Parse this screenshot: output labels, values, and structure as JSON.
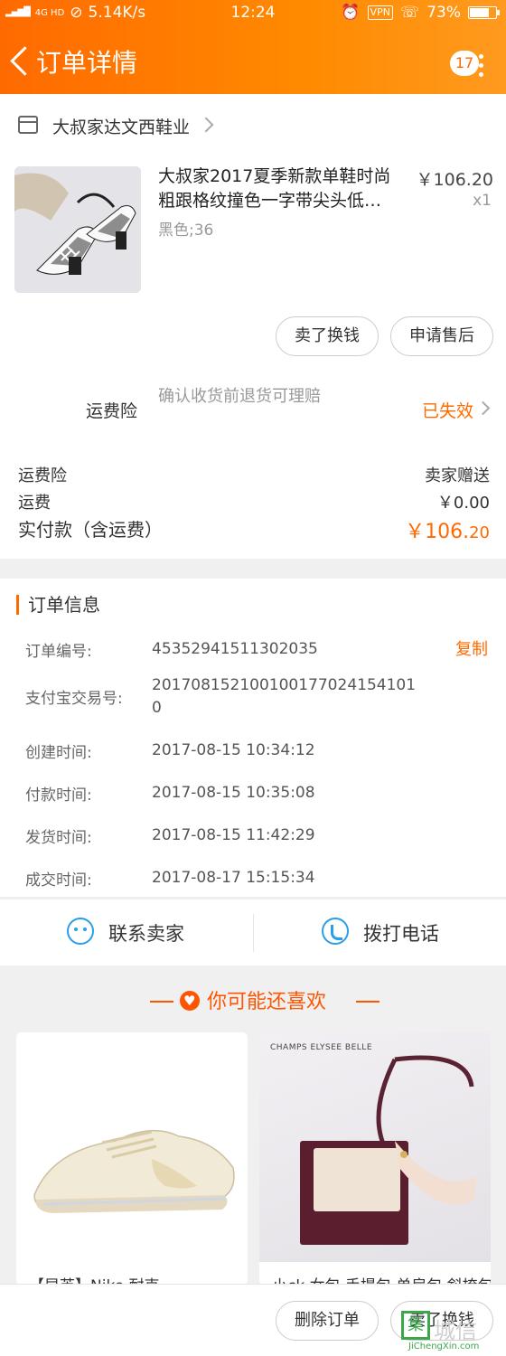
{
  "status_bar": {
    "network": "4G HD",
    "speed": "5.14K/s",
    "time": "12:24",
    "vpn": "VPN",
    "battery": "73%"
  },
  "header": {
    "title": "订单详情",
    "badge_count": "17",
    "back_icon": "chevron-left-icon",
    "more_icon": "more-vertical-icon"
  },
  "shop": {
    "name": "大叔家达文西鞋业"
  },
  "product": {
    "title": "大叔家2017夏季新款单鞋时尚粗跟格纹撞色一字带尖头低…",
    "spec": "黑色;36",
    "price": "￥106.20",
    "qty": "x1"
  },
  "product_actions": {
    "sell": "卖了换钱",
    "aftersale": "申请售后"
  },
  "shipping_insurance": {
    "label": "运费险",
    "desc": "确认收货前退货可理赔",
    "status": "已失效"
  },
  "fees": {
    "insurance_label": "运费险",
    "insurance_value": "卖家赠送",
    "shipping_label": "运费",
    "shipping_value": "￥0.00",
    "total_label": "实付款（含运费）",
    "total_int": "￥106.",
    "total_dec": "20"
  },
  "order_info": {
    "title": "订单信息",
    "copy": "复制",
    "rows": [
      {
        "k": "订单编号:",
        "v": "45352941511302035"
      },
      {
        "k": "支付宝交易号:",
        "v": "2017081521001001770241541010"
      },
      {
        "k": "创建时间:",
        "v": "2017-08-15 10:34:12"
      },
      {
        "k": "付款时间:",
        "v": "2017-08-15 10:35:08"
      },
      {
        "k": "发货时间:",
        "v": "2017-08-15 11:42:29"
      },
      {
        "k": "成交时间:",
        "v": "2017-08-17 15:15:34"
      }
    ]
  },
  "contact": {
    "seller": "联系卖家",
    "phone": "拨打电话"
  },
  "recommend": {
    "title": "你可能还喜欢",
    "items": [
      {
        "name": "【早芙】Nike 耐克"
      },
      {
        "name": "小ck 女包 手提包 单肩包 斜挎包",
        "brand": "CHAMPS ELYSEE BELLE"
      }
    ]
  },
  "bottom_actions": {
    "delete": "删除订单",
    "sell": "卖了换钱"
  },
  "watermark": {
    "glyph": "集",
    "text": "城信",
    "url": "JiChengXin.com"
  },
  "colors": {
    "brand_orange": "#ff6a00",
    "link_blue": "#2a9ee8",
    "watermark_green": "#3aa84a"
  }
}
